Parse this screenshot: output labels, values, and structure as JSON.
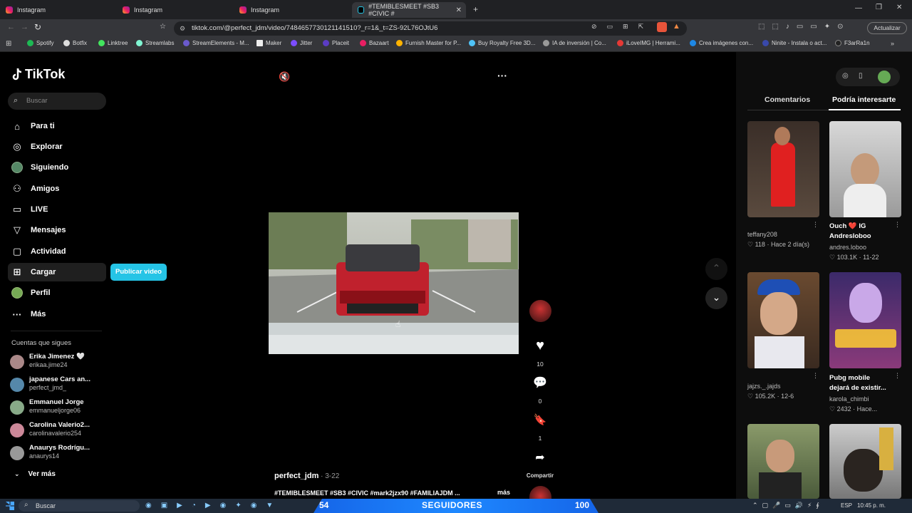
{
  "browser": {
    "tabs": [
      {
        "label": "Instagram"
      },
      {
        "label": "Instagram"
      },
      {
        "label": "Instagram"
      },
      {
        "label": "#TEMIBLESMEET #SB3 #CIVIC #"
      }
    ],
    "url": "tiktok.com/@perfect_jdm/video/7484657730121141510?_r=1&_t=ZS-92L76OJtU6",
    "update_label": "Actualizar",
    "bookmarks": [
      "Spotify",
      "Botfix",
      "Linktree",
      "Streamlabs",
      "StreamElements - M...",
      "Maker",
      "Jitter",
      "Placeit",
      "Bazaart",
      "Furnish Master for P...",
      "Buy Royalty Free 3D...",
      "IA de inversión | Co...",
      "iLoveIMG | Herrami...",
      "Crea imágenes con...",
      "Ninite - Instala o act...",
      "F3arRa1n"
    ]
  },
  "sidebar": {
    "logo": "TikTok",
    "search_placeholder": "Buscar",
    "nav": [
      {
        "label": "Para ti",
        "icon": "home-icon"
      },
      {
        "label": "Explorar",
        "icon": "compass-icon"
      },
      {
        "label": "Siguiendo",
        "icon": "following-avatar-icon"
      },
      {
        "label": "Amigos",
        "icon": "friends-icon"
      },
      {
        "label": "LIVE",
        "icon": "live-icon"
      },
      {
        "label": "Mensajes",
        "icon": "messages-icon"
      },
      {
        "label": "Actividad",
        "icon": "activity-icon"
      },
      {
        "label": "Cargar",
        "icon": "upload-icon"
      },
      {
        "label": "Perfil",
        "icon": "profile-avatar-icon"
      },
      {
        "label": "Más",
        "icon": "more-icon"
      }
    ],
    "upload_button": "Publicar video",
    "following_title": "Cuentas que sigues",
    "following": [
      {
        "name": "Erika Jimenez 🤍",
        "handle": "erikaa.jime24"
      },
      {
        "name": "japanese Cars an...",
        "handle": "perfect_jmd_"
      },
      {
        "name": "Emmanuel Jorge",
        "handle": "emmanueljorge06"
      },
      {
        "name": "Carolina Valerio2...",
        "handle": "carolinavalerio254"
      },
      {
        "name": "Anaurys Rodrígu...",
        "handle": "anaurys14"
      }
    ],
    "see_more": "Ver más"
  },
  "video": {
    "author": "perfect_jdm",
    "date": "3-22",
    "caption": "#TEMIBLESMEET #SB3 #CIVIC #mark2jzx90 #FAMILIAJDM ...",
    "more": "más",
    "likes": "10",
    "comments": "0",
    "saves": "1",
    "share_label": "Compartir"
  },
  "right_panel": {
    "tabs": [
      "Comentarios",
      "Podría interesarte"
    ],
    "cards": [
      {
        "title": "",
        "user": "teffany208",
        "likes": "118",
        "when": "Hace 2 día(s)"
      },
      {
        "title": "Ouch ❤️ IG Andresloboo",
        "user": "andres.loboo",
        "likes": "103.1K",
        "when": "11-22"
      },
      {
        "title": "",
        "user": "jajzs._.jajds",
        "likes": "105.2K",
        "when": "12-6"
      },
      {
        "title": "Pubg mobile dejará de existir...",
        "user": "karola_chimbi",
        "likes": "2432",
        "when": "Hace..."
      }
    ]
  },
  "taskbar": {
    "search": "Buscar",
    "overlay_left": "54",
    "overlay_center": "SEGUIDORES",
    "overlay_right": "100",
    "lang": "ESP",
    "time": "10:45 p. m."
  },
  "colors": {
    "accent": "#25c4e6",
    "like": "#fe2c55"
  }
}
